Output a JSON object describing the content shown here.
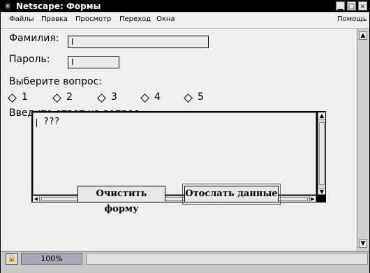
{
  "window": {
    "title": "Netscape: Формы",
    "title_icon": "asterisk-icon",
    "controls": [
      "minimize-icon",
      "maximize-icon",
      "close-icon"
    ],
    "control_glyphs": {
      "minimize": "▁",
      "maximize": "□",
      "close": "×"
    }
  },
  "menu": {
    "items": [
      "Файлы",
      "Правка",
      "Просмотр",
      "Переход",
      "Окна"
    ],
    "help": "Помощь"
  },
  "form": {
    "surname_label": "Фамилия:",
    "surname_value": "I",
    "password_label": "Пароль:",
    "password_value": "I",
    "question_label": "Выберите вопрос:",
    "radio_options": [
      "1",
      "2",
      "3",
      "4",
      "5"
    ],
    "answer_label": "Введите ответ на вопрос:",
    "answer_value": "???",
    "clear_button": "Очистить форму",
    "submit_button": "Отослать данные"
  },
  "status": {
    "progress_value": "100%",
    "lock_icon": "lock-icon",
    "lock_glyph": "🔒"
  }
}
